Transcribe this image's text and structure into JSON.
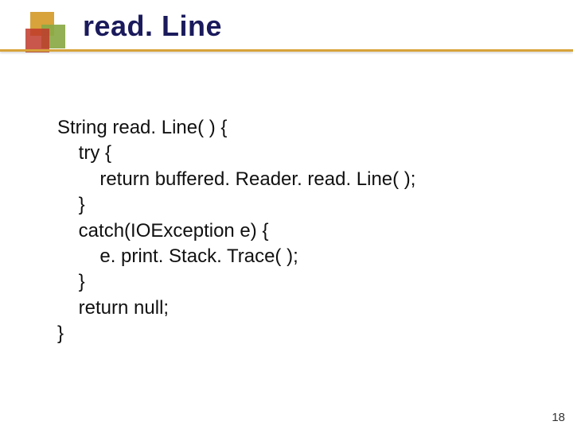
{
  "slide": {
    "title": "read. Line",
    "page_number": "18"
  },
  "code": {
    "l1": "String read. Line( ) {",
    "l2": "    try {",
    "l3": "        return buffered. Reader. read. Line( );",
    "l4": "    }",
    "l5": "    catch(IOException e) {",
    "l6": "        e. print. Stack. Trace( );",
    "l7": "    }",
    "l8": "    return null;",
    "l9": "}"
  }
}
